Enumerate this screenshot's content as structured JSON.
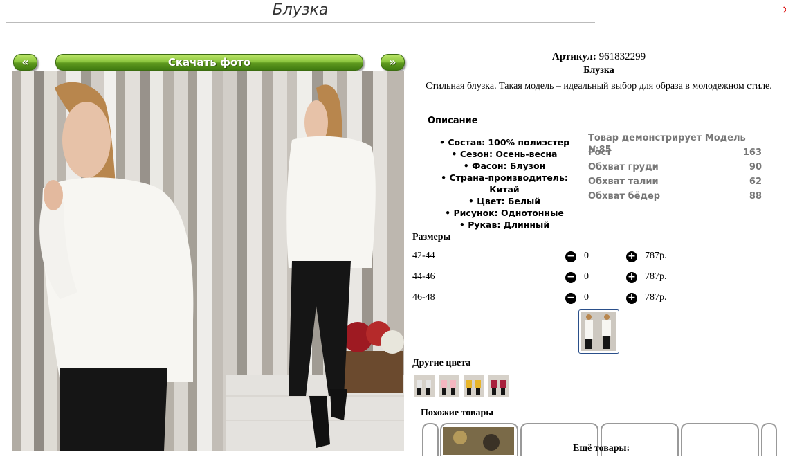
{
  "page": {
    "title": "Блузка",
    "close": "×"
  },
  "buttons": {
    "prev": "«",
    "download": "Скачать фото",
    "next": "»"
  },
  "product": {
    "article_label": "Артикул:",
    "article_value": "961832299",
    "name": "Блузка",
    "description": "Стильная блузка. Такая модель – идеальный выбор для образа в молодежном стиле."
  },
  "specs": {
    "title": "Описание",
    "items": [
      "Состав: 100% полиэстер",
      "Сезон: Осень-весна",
      "Фасон: Блузон",
      "Страна-производитель: Китай",
      "Цвет: Белый",
      "Рисунок: Однотонные",
      "Рукав: Длинный"
    ]
  },
  "model": {
    "title": "Товар демонстрирует Модель №85",
    "rows": [
      {
        "label": "Рост",
        "value": "163"
      },
      {
        "label": "Обхват груди",
        "value": "90"
      },
      {
        "label": "Обхват талии",
        "value": "62"
      },
      {
        "label": "Обхват бёдер",
        "value": "88"
      }
    ]
  },
  "sizes": {
    "title": "Размеры",
    "rows": [
      {
        "size": "42-44",
        "qty": "0",
        "price": "787р."
      },
      {
        "size": "44-46",
        "qty": "0",
        "price": "787р."
      },
      {
        "size": "46-48",
        "qty": "0",
        "price": "787р."
      }
    ]
  },
  "other_colors": {
    "title": "Другие цвета",
    "colors": [
      "#e6e6e6",
      "#f4b6c0",
      "#e8b52a",
      "#a8203c"
    ]
  },
  "similar": {
    "title": "Похожие товары",
    "more": "Ещё товары:"
  },
  "colors": {
    "accent_green": "#5f9a1f",
    "selected_border": "#2a4f8a",
    "muted_text": "#777777"
  }
}
